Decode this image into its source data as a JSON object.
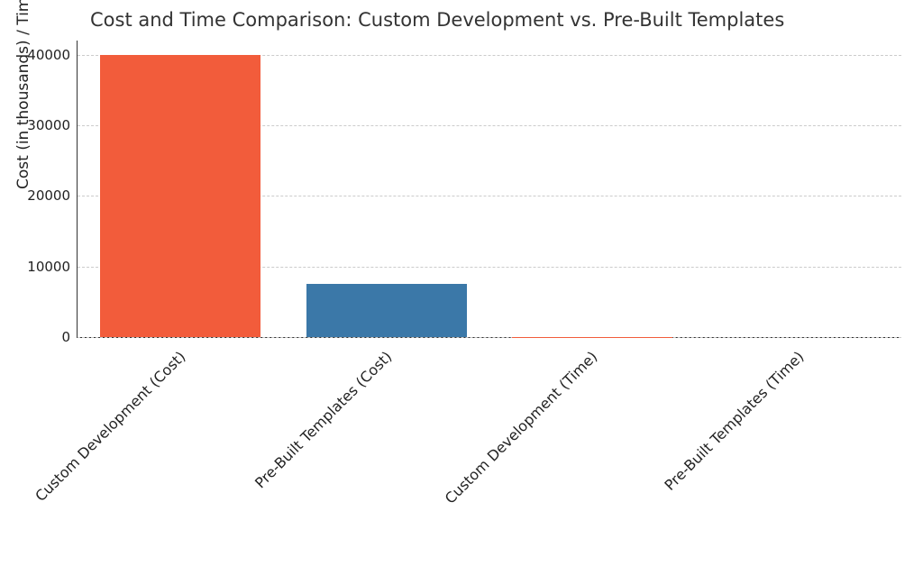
{
  "chart_data": {
    "type": "bar",
    "title": "Cost and Time Comparison: Custom Development vs. Pre-Built Templates",
    "xlabel": "",
    "ylabel": "Cost (in thousands) / Time (in weeks)",
    "categories": [
      "Custom Development (Cost)",
      "Pre-Built Templates (Cost)",
      "Custom Development (Time)",
      "Pre-Built Templates (Time)"
    ],
    "values": [
      40000,
      7500,
      20,
      3
    ],
    "colors": [
      "#f25c3b",
      "#3b78a8",
      "#f25c3b",
      "#3b78a8"
    ],
    "ylim": [
      0,
      42000
    ],
    "yticks": [
      0,
      10000,
      20000,
      30000,
      40000
    ],
    "grid": true
  }
}
